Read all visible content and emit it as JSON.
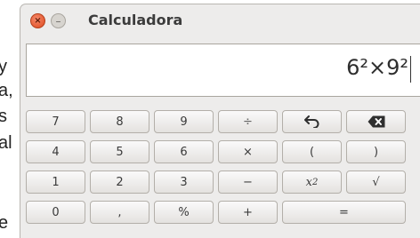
{
  "background_text": {
    "line1": "y",
    "line2": "a,",
    "line3": "s",
    "line4": "al",
    "line5": "e"
  },
  "window": {
    "title": "Calculadora",
    "close_glyph": "×",
    "minimize_glyph": "–"
  },
  "display": {
    "expression": "6²×9²"
  },
  "keypad": {
    "rows": [
      [
        "7",
        "8",
        "9",
        "÷",
        "undo-icon",
        "backspace-icon"
      ],
      [
        "4",
        "5",
        "6",
        "×",
        "(",
        ")"
      ],
      [
        "1",
        "2",
        "3",
        "−",
        "x²",
        "√"
      ],
      [
        "0",
        ",",
        "%",
        "+",
        "="
      ]
    ],
    "k7": "7",
    "k8": "8",
    "k9": "9",
    "divide": "÷",
    "k4": "4",
    "k5": "5",
    "k6": "6",
    "multiply": "×",
    "open_paren": "(",
    "close_paren": ")",
    "k1": "1",
    "k2": "2",
    "k3": "3",
    "subtract": "−",
    "square_base": "x",
    "square_exp": "2",
    "sqrt": "√",
    "k0": "0",
    "comma": ",",
    "percent": "%",
    "add": "+",
    "equals": "="
  },
  "colors": {
    "window_bg": "#edeceb",
    "close_button": "#df4a1f",
    "display_bg": "#ffffff"
  }
}
